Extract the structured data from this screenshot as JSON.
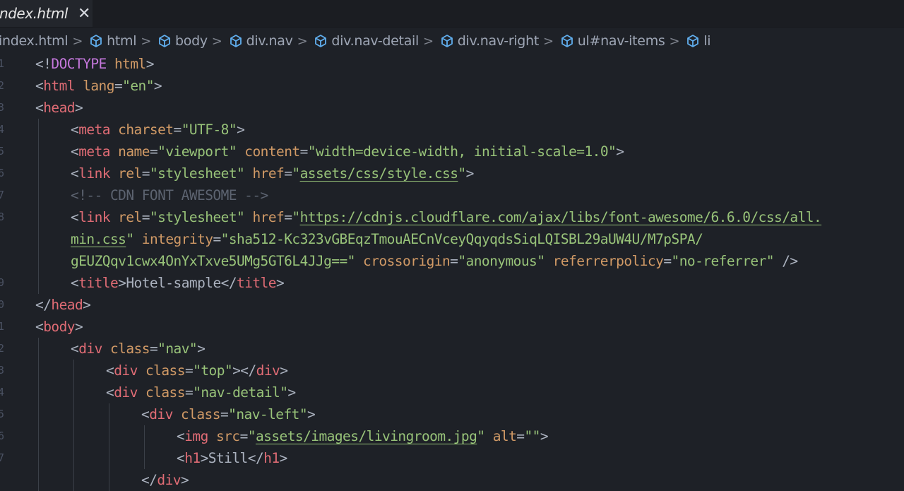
{
  "tab": {
    "label": "index.html",
    "close": "✕"
  },
  "breadcrumb": [
    {
      "label": "index.html",
      "icon": false
    },
    {
      "label": "html",
      "icon": true
    },
    {
      "label": "body",
      "icon": true
    },
    {
      "label": "div.nav",
      "icon": true
    },
    {
      "label": "div.nav-detail",
      "icon": true
    },
    {
      "label": "div.nav-right",
      "icon": true
    },
    {
      "label": "ul#nav-items",
      "icon": true
    },
    {
      "label": "li",
      "icon": true
    }
  ],
  "breadcrumb_separator": ">",
  "line_numbers": [
    "1",
    "2",
    "3",
    "4",
    "5",
    "6",
    "7",
    "8",
    "",
    "",
    "9",
    "0",
    "1",
    "2",
    "3",
    "4",
    "5",
    "6",
    "7"
  ],
  "code_lines": [
    {
      "indent": 0,
      "tokens": [
        [
          "p",
          "<!"
        ],
        [
          "d",
          "DOCTYPE"
        ],
        [
          "p",
          " "
        ],
        [
          "a",
          "html"
        ],
        [
          "p",
          ">"
        ]
      ]
    },
    {
      "indent": 0,
      "tokens": [
        [
          "p",
          "<"
        ],
        [
          "t",
          "html"
        ],
        [
          "p",
          " "
        ],
        [
          "a",
          "lang"
        ],
        [
          "p",
          "="
        ],
        [
          "s",
          "\"en\""
        ],
        [
          "p",
          ">"
        ]
      ]
    },
    {
      "indent": 0,
      "tokens": [
        [
          "p",
          "<"
        ],
        [
          "t",
          "head"
        ],
        [
          "p",
          ">"
        ]
      ]
    },
    {
      "indent": 1,
      "tokens": [
        [
          "p",
          "<"
        ],
        [
          "t",
          "meta"
        ],
        [
          "p",
          " "
        ],
        [
          "a",
          "charset"
        ],
        [
          "p",
          "="
        ],
        [
          "s",
          "\"UTF-8\""
        ],
        [
          "p",
          ">"
        ]
      ]
    },
    {
      "indent": 1,
      "tokens": [
        [
          "p",
          "<"
        ],
        [
          "t",
          "meta"
        ],
        [
          "p",
          " "
        ],
        [
          "a",
          "name"
        ],
        [
          "p",
          "="
        ],
        [
          "s",
          "\"viewport\""
        ],
        [
          "p",
          " "
        ],
        [
          "a",
          "content"
        ],
        [
          "p",
          "="
        ],
        [
          "s",
          "\"width=device-width, initial-scale=1.0\""
        ],
        [
          "p",
          ">"
        ]
      ]
    },
    {
      "indent": 1,
      "tokens": [
        [
          "p",
          "<"
        ],
        [
          "t",
          "link"
        ],
        [
          "p",
          " "
        ],
        [
          "a",
          "rel"
        ],
        [
          "p",
          "="
        ],
        [
          "s",
          "\"stylesheet\""
        ],
        [
          "p",
          " "
        ],
        [
          "a",
          "href"
        ],
        [
          "p",
          "="
        ],
        [
          "s",
          "\""
        ],
        [
          "u",
          "assets/css/style.css"
        ],
        [
          "s",
          "\""
        ],
        [
          "p",
          ">"
        ]
      ]
    },
    {
      "indent": 1,
      "tokens": [
        [
          "c",
          "<!-- CDN FONT AWESOME -->"
        ]
      ]
    },
    {
      "indent": 1,
      "tokens": [
        [
          "p",
          "<"
        ],
        [
          "t",
          "link"
        ],
        [
          "p",
          " "
        ],
        [
          "a",
          "rel"
        ],
        [
          "p",
          "="
        ],
        [
          "s",
          "\"stylesheet\""
        ],
        [
          "p",
          " "
        ],
        [
          "a",
          "href"
        ],
        [
          "p",
          "="
        ],
        [
          "s",
          "\""
        ],
        [
          "u",
          "https://cdnjs.cloudflare.com/ajax/libs/font-awesome/6.6.0/css/all."
        ]
      ]
    },
    {
      "indent": 1,
      "tokens": [
        [
          "u",
          "min.css"
        ],
        [
          "s",
          "\""
        ],
        [
          "p",
          " "
        ],
        [
          "a",
          "integrity"
        ],
        [
          "p",
          "="
        ],
        [
          "s",
          "\"sha512-Kc323vGBEqzTmouAECnVceyQqyqdsSiqLQISBL29aUW4U/M7pSPA/"
        ]
      ]
    },
    {
      "indent": 1,
      "tokens": [
        [
          "s",
          "gEUZQqv1cwx4OnYxTxve5UMg5GT6L4JJg==\""
        ],
        [
          "p",
          " "
        ],
        [
          "a",
          "crossorigin"
        ],
        [
          "p",
          "="
        ],
        [
          "s",
          "\"anonymous\""
        ],
        [
          "p",
          " "
        ],
        [
          "a",
          "referrerpolicy"
        ],
        [
          "p",
          "="
        ],
        [
          "s",
          "\"no-referrer\""
        ],
        [
          "p",
          " />"
        ]
      ]
    },
    {
      "indent": 1,
      "tokens": [
        [
          "p",
          "<"
        ],
        [
          "t",
          "title"
        ],
        [
          "p",
          ">"
        ],
        [
          "x",
          "Hotel-sample"
        ],
        [
          "p",
          "</"
        ],
        [
          "t",
          "title"
        ],
        [
          "p",
          ">"
        ]
      ]
    },
    {
      "indent": 0,
      "tokens": [
        [
          "p",
          "</"
        ],
        [
          "t",
          "head"
        ],
        [
          "p",
          ">"
        ]
      ]
    },
    {
      "indent": 0,
      "tokens": [
        [
          "p",
          "<"
        ],
        [
          "t",
          "body"
        ],
        [
          "p",
          ">"
        ]
      ]
    },
    {
      "indent": 1,
      "tokens": [
        [
          "p",
          "<"
        ],
        [
          "t",
          "div"
        ],
        [
          "p",
          " "
        ],
        [
          "a",
          "class"
        ],
        [
          "p",
          "="
        ],
        [
          "s",
          "\"nav\""
        ],
        [
          "p",
          ">"
        ]
      ]
    },
    {
      "indent": 2,
      "tokens": [
        [
          "p",
          "<"
        ],
        [
          "t",
          "div"
        ],
        [
          "p",
          " "
        ],
        [
          "a",
          "class"
        ],
        [
          "p",
          "="
        ],
        [
          "s",
          "\"top\""
        ],
        [
          "p",
          "></"
        ],
        [
          "t",
          "div"
        ],
        [
          "p",
          ">"
        ]
      ]
    },
    {
      "indent": 2,
      "tokens": [
        [
          "p",
          "<"
        ],
        [
          "t",
          "div"
        ],
        [
          "p",
          " "
        ],
        [
          "a",
          "class"
        ],
        [
          "p",
          "="
        ],
        [
          "s",
          "\"nav-detail\""
        ],
        [
          "p",
          ">"
        ]
      ]
    },
    {
      "indent": 3,
      "tokens": [
        [
          "p",
          "<"
        ],
        [
          "t",
          "div"
        ],
        [
          "p",
          " "
        ],
        [
          "a",
          "class"
        ],
        [
          "p",
          "="
        ],
        [
          "s",
          "\"nav-left\""
        ],
        [
          "p",
          ">"
        ]
      ]
    },
    {
      "indent": 4,
      "tokens": [
        [
          "p",
          "<"
        ],
        [
          "t",
          "img"
        ],
        [
          "p",
          " "
        ],
        [
          "a",
          "src"
        ],
        [
          "p",
          "="
        ],
        [
          "s",
          "\""
        ],
        [
          "u",
          "assets/images/livingroom.jpg"
        ],
        [
          "s",
          "\""
        ],
        [
          "p",
          " "
        ],
        [
          "a",
          "alt"
        ],
        [
          "p",
          "="
        ],
        [
          "s",
          "\"\""
        ],
        [
          "p",
          ">"
        ]
      ]
    },
    {
      "indent": 4,
      "tokens": [
        [
          "p",
          "<"
        ],
        [
          "t",
          "h1"
        ],
        [
          "p",
          ">"
        ],
        [
          "x",
          "Still"
        ],
        [
          "p",
          "</"
        ],
        [
          "t",
          "h1"
        ],
        [
          "p",
          ">"
        ]
      ]
    },
    {
      "indent": 3,
      "tokens": [
        [
          "p",
          "</"
        ],
        [
          "t",
          "div"
        ],
        [
          "p",
          ">"
        ]
      ]
    }
  ]
}
